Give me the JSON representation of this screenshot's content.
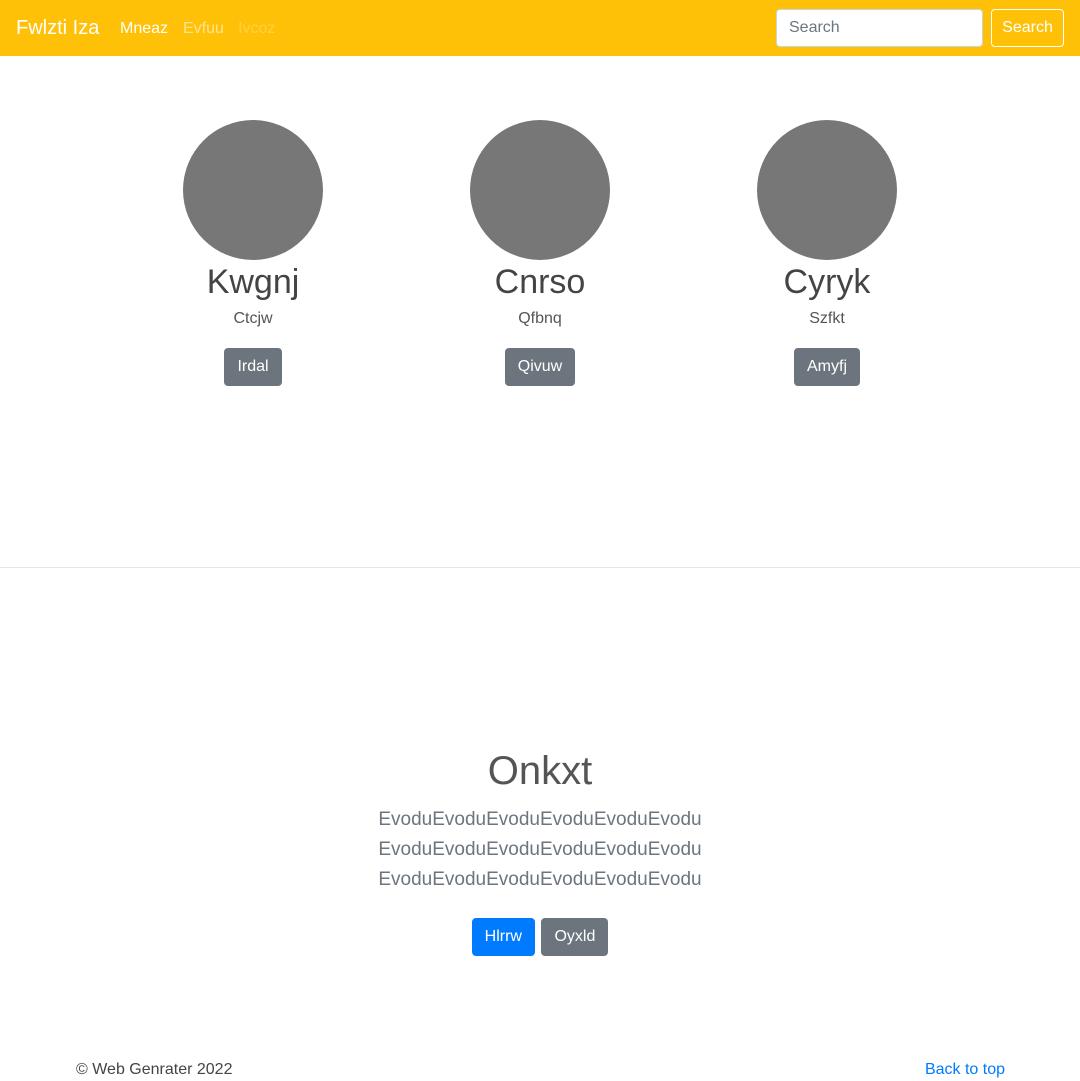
{
  "navbar": {
    "brand": "Fwlzti Iza",
    "links": [
      "Mneaz",
      "Evfuu",
      "Ivcoz"
    ],
    "search_placeholder": "Search",
    "search_button": "Search",
    "background": "#ffc107"
  },
  "profiles": [
    {
      "name": "Kwgnj",
      "subtitle": "Ctcjw",
      "button": "Irdal"
    },
    {
      "name": "Cnrso",
      "subtitle": "Qfbnq",
      "button": "Qivuw"
    },
    {
      "name": "Cyryk",
      "subtitle": "Szfkt",
      "button": "Amyfj"
    }
  ],
  "hero": {
    "title": "Onkxt",
    "text": "EvoduEvoduEvoduEvoduEvoduEvoduEvoduEvoduEvoduEvoduEvoduEvoduEvoduEvoduEvoduEvoduEvoduEvodu",
    "primary_button": "Hlrrw",
    "secondary_button": "Oyxld"
  },
  "footer": {
    "copyright": "© Web Genrater 2022",
    "back_to_top": "Back to top"
  }
}
